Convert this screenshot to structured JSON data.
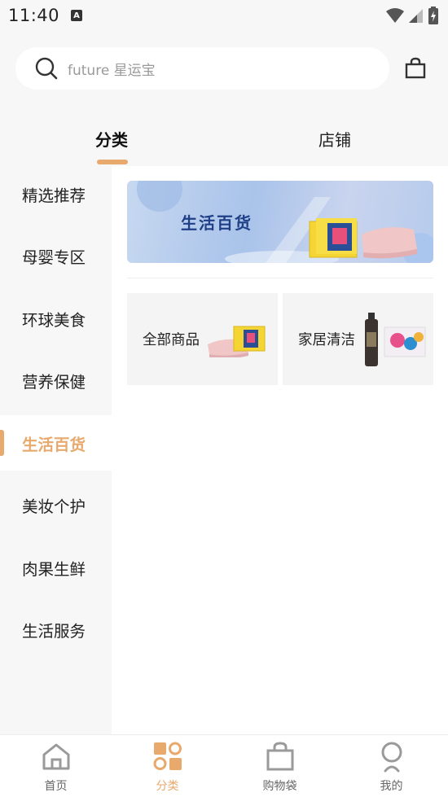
{
  "status_bar": {
    "time": "11:40",
    "notification_icon": "A"
  },
  "search": {
    "placeholder": "future 星运宝"
  },
  "tabs": [
    {
      "label": "分类",
      "active": true
    },
    {
      "label": "店铺",
      "active": false
    }
  ],
  "sidebar": {
    "items": [
      {
        "label": "精选推荐"
      },
      {
        "label": "母婴专区"
      },
      {
        "label": "环球美食"
      },
      {
        "label": "营养保健"
      },
      {
        "label": "生活百货",
        "active": true
      },
      {
        "label": "美妆个护"
      },
      {
        "label": "肉果生鲜"
      },
      {
        "label": "生活服务"
      }
    ]
  },
  "banner": {
    "title": "生活百货"
  },
  "categories": [
    {
      "label": "全部商品"
    },
    {
      "label": "家居清洁"
    }
  ],
  "bottom_nav": [
    {
      "label": "首页",
      "icon": "home-icon"
    },
    {
      "label": "分类",
      "icon": "category-icon",
      "active": true
    },
    {
      "label": "购物袋",
      "icon": "shopping-bag-icon"
    },
    {
      "label": "我的",
      "icon": "profile-icon"
    }
  ],
  "colors": {
    "accent": "#e8a96c",
    "banner_title": "#1f3f86"
  }
}
